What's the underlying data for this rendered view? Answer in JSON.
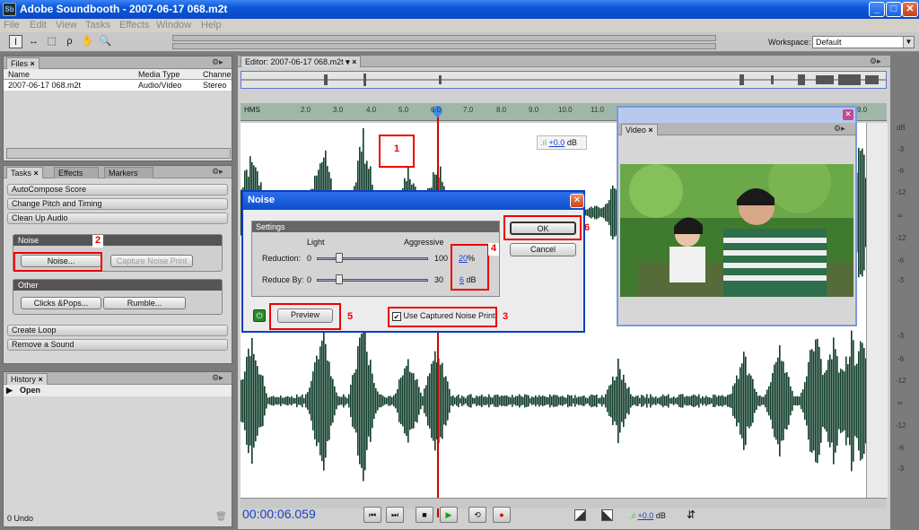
{
  "window": {
    "title": "Adobe Soundbooth - 2007-06-17 068.m2t",
    "app_icon": "Sb",
    "controls": [
      "_",
      "□",
      "✕"
    ]
  },
  "menu": [
    "File",
    "Edit",
    "View",
    "Tasks",
    "Effects",
    "Window",
    "Help"
  ],
  "workspace": {
    "label": "Workspace:",
    "value": "Default"
  },
  "files_panel": {
    "tab": "Files",
    "columns": [
      "Name",
      "Media Type",
      "Channe"
    ],
    "rows": [
      {
        "name": "2007-06-17 068.m2t",
        "media_type": "Audio/Video",
        "channels": "Stereo"
      }
    ]
  },
  "tasks_panel": {
    "tabs": [
      "Tasks",
      "Effects",
      "Markers"
    ],
    "items": [
      "AutoCompose Score",
      "Change Pitch and Timing",
      "Clean Up Audio"
    ],
    "noise_section": {
      "title": "Noise",
      "noise_button": "Noise...",
      "capture_button": "Capture Noise Print"
    },
    "other_section": {
      "title": "Other",
      "clicks_button": "Clicks &Pops...",
      "rumble_button": "Rumble..."
    },
    "bottom_items": [
      "Create Loop",
      "Remove a Sound"
    ]
  },
  "history_panel": {
    "tab": "History",
    "item": "Open",
    "status": "0 Undo"
  },
  "editor": {
    "tab": "Editor: 2007-06-17 068.m2t",
    "ruler_label": "HMS",
    "ticks": [
      "2.0",
      "3.0",
      "4.0",
      "5.0",
      "6.0",
      "7.0",
      "8.0",
      "9.0",
      "10.0",
      "11.0",
      "9.0"
    ],
    "gain": "+0.0",
    "gain_unit": "dB",
    "db_labels_top": [
      "dB",
      "-3",
      "-6",
      "-12",
      "∞",
      "-12",
      "-6",
      "-3"
    ],
    "db_labels_bottom": [
      "-3",
      "-6",
      "-12",
      "∞",
      "-12",
      "-6",
      "-3"
    ],
    "timecode": "00:00:06.059",
    "bottom_gain": "+0.0",
    "bottom_gain_unit": "dB"
  },
  "noise_dialog": {
    "title": "Noise",
    "settings_label": "Settings",
    "light": "Light",
    "aggressive": "Aggressive",
    "reduction": {
      "label": "Reduction:",
      "min": "0",
      "max": "100",
      "value": "20",
      "unit": "%",
      "level": 0.2
    },
    "reduce_by": {
      "label": "Reduce By:",
      "min": "0",
      "max": "30",
      "value": "6",
      "unit": "dB",
      "level": 0.2
    },
    "ok": "OK",
    "cancel": "Cancel",
    "preview": "Preview",
    "use_captured": "Use Captured Noise Print",
    "use_captured_checked": true
  },
  "video_panel": {
    "tab": "Video"
  },
  "annotations": [
    "1",
    "2",
    "3",
    "4",
    "5",
    "6"
  ],
  "colors": {
    "wave": "#0f3d2a",
    "titlebar": "#0b56d8",
    "annotation": "#e00000",
    "playhead": "#d40000",
    "link": "#1b3ec8"
  }
}
